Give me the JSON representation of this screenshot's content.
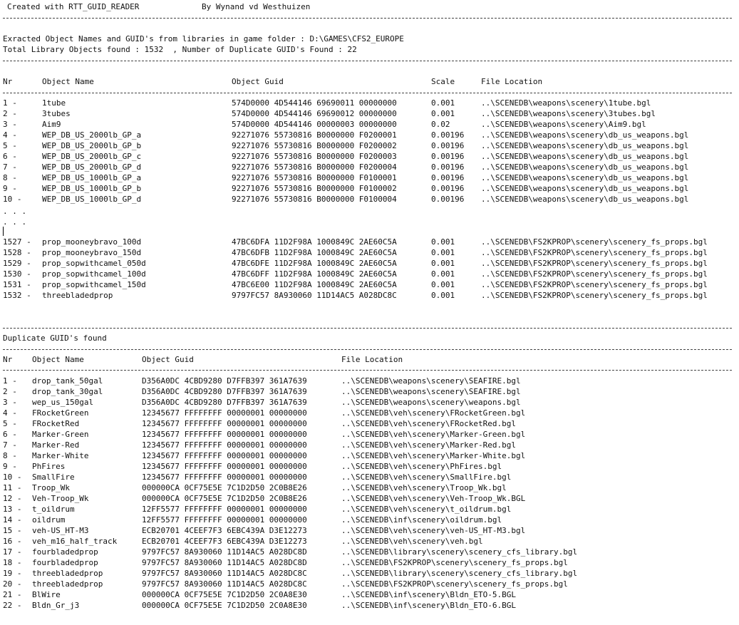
{
  "header": {
    "created_with": "Created with RTT_GUID_READER",
    "author": "By Wynand vd Westhuizen"
  },
  "summary": {
    "extracted_line": "Exracted Object Names and GUID's from libraries in game folder : D:\\GAMES\\CFS2_EUROPE",
    "totals_line": "Total Library Objects found : 1532  , Number of Duplicate GUID's Found : 22"
  },
  "objects": {
    "headers": {
      "nr": "Nr",
      "name": "Object Name",
      "guid": "Object Guid",
      "scale": "Scale",
      "location": "File Location"
    },
    "rows_top": [
      {
        "nr": "1 -",
        "name": "1tube",
        "guid": "574D0000 4D544146 69690011 00000000",
        "scale": "0.001",
        "location": "..\\SCENEDB\\weapons\\scenery\\1tube.bgl"
      },
      {
        "nr": "2 -",
        "name": "3tubes",
        "guid": "574D0000 4D544146 69690012 00000000",
        "scale": "0.001",
        "location": "..\\SCENEDB\\weapons\\scenery\\3tubes.bgl"
      },
      {
        "nr": "3 -",
        "name": "Aim9",
        "guid": "574D0000 4D544146 00000003 00000000",
        "scale": "0.02",
        "location": "..\\SCENEDB\\weapons\\scenery\\Aim9.bgl"
      },
      {
        "nr": "4 -",
        "name": "WEP_DB_US_2000lb_GP_a",
        "guid": "92271076 55730816 B0000000 F0200001",
        "scale": "0.00196",
        "location": "..\\SCENEDB\\weapons\\scenery\\db_us_weapons.bgl"
      },
      {
        "nr": "5 -",
        "name": "WEP_DB_US_2000lb_GP_b",
        "guid": "92271076 55730816 B0000000 F0200002",
        "scale": "0.00196",
        "location": "..\\SCENEDB\\weapons\\scenery\\db_us_weapons.bgl"
      },
      {
        "nr": "6 -",
        "name": "WEP_DB_US_2000lb_GP_c",
        "guid": "92271076 55730816 B0000000 F0200003",
        "scale": "0.00196",
        "location": "..\\SCENEDB\\weapons\\scenery\\db_us_weapons.bgl"
      },
      {
        "nr": "7 -",
        "name": "WEP_DB_US_2000lb_GP_d",
        "guid": "92271076 55730816 B0000000 F0200004",
        "scale": "0.00196",
        "location": "..\\SCENEDB\\weapons\\scenery\\db_us_weapons.bgl"
      },
      {
        "nr": "8 -",
        "name": "WEP_DB_US_1000lb_GP_a",
        "guid": "92271076 55730816 B0000000 F0100001",
        "scale": "0.00196",
        "location": "..\\SCENEDB\\weapons\\scenery\\db_us_weapons.bgl"
      },
      {
        "nr": "9 -",
        "name": "WEP_DB_US_1000lb_GP_b",
        "guid": "92271076 55730816 B0000000 F0100002",
        "scale": "0.00196",
        "location": "..\\SCENEDB\\weapons\\scenery\\db_us_weapons.bgl"
      },
      {
        "nr": "10 -",
        "name": "WEP_DB_US_1000lb_GP_d",
        "guid": "92271076 55730816 B0000000 F0100004",
        "scale": "0.00196",
        "location": "..\\SCENEDB\\weapons\\scenery\\db_us_weapons.bgl"
      }
    ],
    "ellipsis": ". . .",
    "rows_bottom": [
      {
        "nr": "1527 -",
        "name": "prop_mooneybravo_100d",
        "guid": "47BC6DFA 11D2F98A 1000849C 2AE60C5A",
        "scale": "0.001",
        "location": "..\\SCENEDB\\FS2KPROP\\scenery\\scenery_fs_props.bgl"
      },
      {
        "nr": "1528 -",
        "name": "prop_mooneybravo_150d",
        "guid": "47BC6DFB 11D2F98A 1000849C 2AE60C5A",
        "scale": "0.001",
        "location": "..\\SCENEDB\\FS2KPROP\\scenery\\scenery_fs_props.bgl"
      },
      {
        "nr": "1529 -",
        "name": "prop_sopwithcamel_050d",
        "guid": "47BC6DFE 11D2F98A 1000849C 2AE60C5A",
        "scale": "0.001",
        "location": "..\\SCENEDB\\FS2KPROP\\scenery\\scenery_fs_props.bgl"
      },
      {
        "nr": "1530 -",
        "name": "prop_sopwithcamel_100d",
        "guid": "47BC6DFF 11D2F98A 1000849C 2AE60C5A",
        "scale": "0.001",
        "location": "..\\SCENEDB\\FS2KPROP\\scenery\\scenery_fs_props.bgl"
      },
      {
        "nr": "1531 -",
        "name": "prop_sopwithcamel_150d",
        "guid": "47BC6E00 11D2F98A 1000849C 2AE60C5A",
        "scale": "0.001",
        "location": "..\\SCENEDB\\FS2KPROP\\scenery\\scenery_fs_props.bgl"
      },
      {
        "nr": "1532 -",
        "name": "threebladedprop",
        "guid": "9797FC57 8A930060 11D14AC5 A028DC8C",
        "scale": "0.001",
        "location": "..\\SCENEDB\\FS2KPROP\\scenery\\scenery_fs_props.bgl"
      }
    ]
  },
  "duplicates": {
    "title": "Duplicate GUID's found",
    "headers": {
      "nr": "Nr",
      "name": "Object Name",
      "guid": "Object Guid",
      "location": "File Location"
    },
    "rows": [
      {
        "nr": "1 -",
        "name": "drop_tank_50gal",
        "guid": "D356A0DC 4CBD9280 D7FFB397 361A7639",
        "location": "..\\SCENEDB\\weapons\\scenery\\SEAFIRE.bgl"
      },
      {
        "nr": "2 -",
        "name": "drop_tank_30gal",
        "guid": "D356A0DC 4CBD9280 D7FFB397 361A7639",
        "location": "..\\SCENEDB\\weapons\\scenery\\SEAFIRE.bgl"
      },
      {
        "nr": "3 -",
        "name": "wep_us_150gal",
        "guid": "D356A0DC 4CBD9280 D7FFB397 361A7639",
        "location": "..\\SCENEDB\\weapons\\scenery\\weapons.bgl"
      },
      {
        "nr": "4 -",
        "name": "FRocketGreen",
        "guid": "12345677 FFFFFFFF 00000001 00000000",
        "location": "..\\SCENEDB\\veh\\scenery\\FRocketGreen.bgl"
      },
      {
        "nr": "5 -",
        "name": "FRocketRed",
        "guid": "12345677 FFFFFFFF 00000001 00000000",
        "location": "..\\SCENEDB\\veh\\scenery\\FRocketRed.bgl"
      },
      {
        "nr": "6 -",
        "name": "Marker-Green",
        "guid": "12345677 FFFFFFFF 00000001 00000000",
        "location": "..\\SCENEDB\\veh\\scenery\\Marker-Green.bgl"
      },
      {
        "nr": "7 -",
        "name": "Marker-Red",
        "guid": "12345677 FFFFFFFF 00000001 00000000",
        "location": "..\\SCENEDB\\veh\\scenery\\Marker-Red.bgl"
      },
      {
        "nr": "8 -",
        "name": "Marker-White",
        "guid": "12345677 FFFFFFFF 00000001 00000000",
        "location": "..\\SCENEDB\\veh\\scenery\\Marker-White.bgl"
      },
      {
        "nr": "9 -",
        "name": "PhFires",
        "guid": "12345677 FFFFFFFF 00000001 00000000",
        "location": "..\\SCENEDB\\veh\\scenery\\PhFires.bgl"
      },
      {
        "nr": "10 -",
        "name": "SmallFire",
        "guid": "12345677 FFFFFFFF 00000001 00000000",
        "location": "..\\SCENEDB\\veh\\scenery\\SmallFire.bgl"
      },
      {
        "nr": "11 -",
        "name": "Troop_Wk",
        "guid": "000000CA 0CF75E5E 7C1D2D50 2C0B8E26",
        "location": "..\\SCENEDB\\veh\\scenery\\Troop_Wk.bgl"
      },
      {
        "nr": "12 -",
        "name": "Veh-Troop_Wk",
        "guid": "000000CA 0CF75E5E 7C1D2D50 2C0B8E26",
        "location": "..\\SCENEDB\\veh\\scenery\\Veh-Troop_Wk.BGL"
      },
      {
        "nr": "13 -",
        "name": "t_oildrum",
        "guid": "12FF5577 FFFFFFFF 00000001 00000000",
        "location": "..\\SCENEDB\\veh\\scenery\\t_oildrum.bgl"
      },
      {
        "nr": "14 -",
        "name": "oildrum",
        "guid": "12FF5577 FFFFFFFF 00000001 00000000",
        "location": "..\\SCENEDB\\inf\\scenery\\oildrum.bgl"
      },
      {
        "nr": "15 -",
        "name": "veh-US_HT-M3",
        "guid": "ECB20701 4CEEF7F3 6EBC439A D3E12273",
        "location": "..\\SCENEDB\\veh\\scenery\\veh-US_HT-M3.bgl"
      },
      {
        "nr": "16 -",
        "name": "veh_m16_half_track",
        "guid": "ECB20701 4CEEF7F3 6EBC439A D3E12273",
        "location": "..\\SCENEDB\\veh\\scenery\\veh.bgl"
      },
      {
        "nr": "17 -",
        "name": "fourbladedprop",
        "guid": "9797FC57 8A930060 11D14AC5 A028DC8D",
        "location": "..\\SCENEDB\\library\\scenery\\scenery_cfs_library.bgl"
      },
      {
        "nr": "18 -",
        "name": "fourbladedprop",
        "guid": "9797FC57 8A930060 11D14AC5 A028DC8D",
        "location": "..\\SCENEDB\\FS2KPROP\\scenery\\scenery_fs_props.bgl"
      },
      {
        "nr": "19 -",
        "name": "threebladedprop",
        "guid": "9797FC57 8A930060 11D14AC5 A028DC8C",
        "location": "..\\SCENEDB\\library\\scenery\\scenery_cfs_library.bgl"
      },
      {
        "nr": "20 -",
        "name": "threebladedprop",
        "guid": "9797FC57 8A930060 11D14AC5 A028DC8C",
        "location": "..\\SCENEDB\\FS2KPROP\\scenery\\scenery_fs_props.bgl"
      },
      {
        "nr": "21 -",
        "name": "BlWire",
        "guid": "000000CA 0CF75E5E 7C1D2D50 2C0A8E30",
        "location": "..\\SCENEDB\\inf\\scenery\\Bldn_ETO-5.BGL"
      },
      {
        "nr": "22 -",
        "name": "Bldn_Gr_j3",
        "guid": "000000CA 0CF75E5E 7C1D2D50 2C0A8E30",
        "location": "..\\SCENEDB\\inf\\scenery\\Bldn_ETO-6.BGL"
      }
    ]
  }
}
